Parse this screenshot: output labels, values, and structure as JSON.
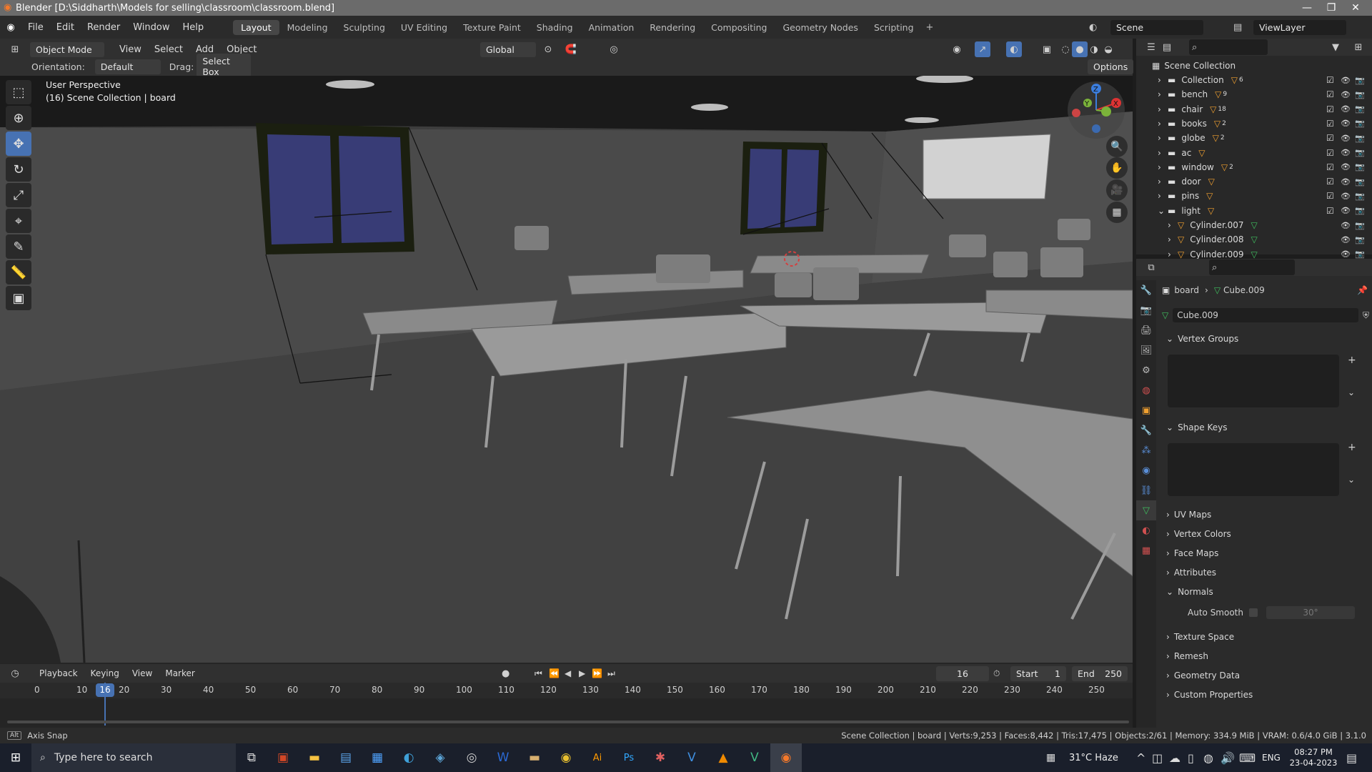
{
  "window": {
    "title": "Blender [D:\\Siddharth\\Models for selling\\classroom\\classroom.blend]",
    "minimize": "—",
    "maximize": "❐",
    "close": "✕"
  },
  "menus": [
    "File",
    "Edit",
    "Render",
    "Window",
    "Help"
  ],
  "workspaces": [
    "Layout",
    "Modeling",
    "Sculpting",
    "UV Editing",
    "Texture Paint",
    "Shading",
    "Animation",
    "Rendering",
    "Compositing",
    "Geometry Nodes",
    "Scripting"
  ],
  "topright": {
    "scene": "Scene",
    "viewlayer": "ViewLayer"
  },
  "viewport_header": {
    "mode": "Object Mode",
    "menus": [
      "View",
      "Select",
      "Add",
      "Object"
    ],
    "transform": "Global",
    "options": "Options"
  },
  "tool_settings": {
    "orientation_label": "Orientation:",
    "orientation": "Default",
    "drag_label": "Drag:",
    "drag": "Select Box"
  },
  "viewport_info": {
    "line1": "User Perspective",
    "line2": "(16) Scene Collection | board"
  },
  "outliner": {
    "root": "Scene Collection",
    "items": [
      {
        "name": "Collection",
        "badge": "6",
        "level": 0
      },
      {
        "name": "bench",
        "badge": "9",
        "level": 0
      },
      {
        "name": "chair",
        "badge": "18",
        "level": 0
      },
      {
        "name": "books",
        "badge": "2",
        "level": 0
      },
      {
        "name": "globe",
        "badge": "2",
        "level": 0
      },
      {
        "name": "ac",
        "badge": "",
        "level": 0
      },
      {
        "name": "window",
        "badge": "2",
        "level": 0
      },
      {
        "name": "door",
        "badge": "",
        "level": 0
      },
      {
        "name": "pins",
        "badge": "",
        "level": 0
      },
      {
        "name": "light",
        "badge": "",
        "level": 0
      },
      {
        "name": "Cylinder.007",
        "badge": "",
        "level": 1
      },
      {
        "name": "Cylinder.008",
        "badge": "",
        "level": 1
      },
      {
        "name": "Cylinder.009",
        "badge": "",
        "level": 1
      }
    ]
  },
  "properties": {
    "breadcrumb_object": "board",
    "breadcrumb_mesh": "Cube.009",
    "mesh_name": "Cube.009",
    "panels": {
      "vertex_groups": "Vertex Groups",
      "shape_keys": "Shape Keys",
      "uv_maps": "UV Maps",
      "vertex_colors": "Vertex Colors",
      "face_maps": "Face Maps",
      "attributes": "Attributes",
      "normals": "Normals",
      "auto_smooth": "Auto Smooth",
      "auto_smooth_angle": "30°",
      "texture_space": "Texture Space",
      "remesh": "Remesh",
      "geometry_data": "Geometry Data",
      "custom_properties": "Custom Properties"
    }
  },
  "timeline": {
    "menus": [
      "Playback",
      "Keying",
      "View",
      "Marker"
    ],
    "current_frame": "16",
    "start_label": "Start",
    "start": "1",
    "end_label": "End",
    "end": "250",
    "ticks": [
      "0",
      "10",
      "20",
      "30",
      "40",
      "50",
      "60",
      "70",
      "80",
      "90",
      "100",
      "110",
      "120",
      "130",
      "140",
      "150",
      "160",
      "170",
      "180",
      "190",
      "200",
      "210",
      "220",
      "230",
      "240",
      "250"
    ],
    "playhead": "16"
  },
  "status": {
    "left": "Axis Snap",
    "right": "Scene Collection | board | Verts:9,253 | Faces:8,442 | Tris:17,475 | Objects:2/61 | Memory: 334.9 MiB | VRAM: 0.6/4.0 GiB | 3.1.0"
  },
  "taskbar": {
    "search_placeholder": "Type here to search",
    "weather": "31°C  Haze",
    "lang": "ENG",
    "time": "08:27 PM",
    "date": "23-04-2023"
  }
}
